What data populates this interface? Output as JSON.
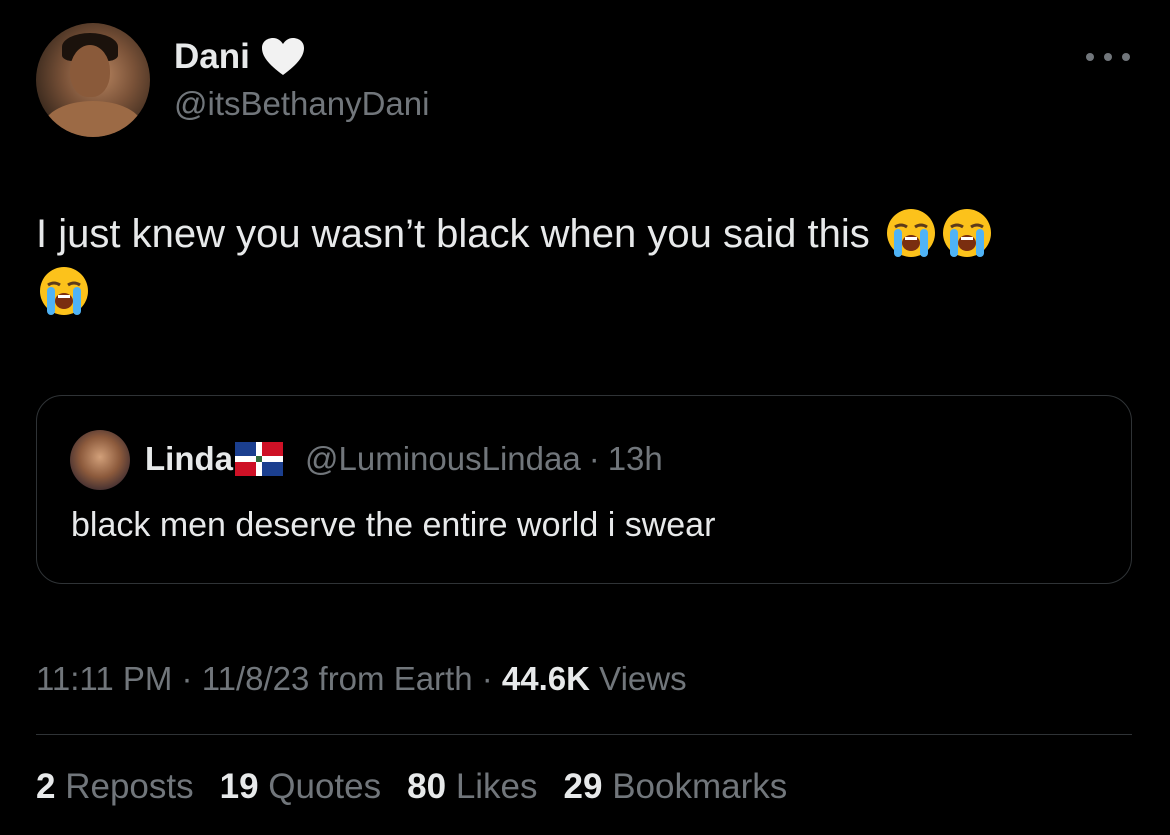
{
  "author": {
    "display_name": "Dani",
    "handle": "@itsBethanyDani",
    "badge_icon": "white-heart-icon"
  },
  "tweet": {
    "text": "I just knew you wasn’t black when you said this",
    "emoji_icon": "loudly-crying-face-icon",
    "emoji_count": 3
  },
  "quote": {
    "name": "Linda",
    "flag_icon": "dominican-republic-flag-icon",
    "handle": "@LuminousLindaa",
    "separator": "·",
    "time": "13h",
    "text": "black men deserve the entire world i swear"
  },
  "meta": {
    "time": "11:11 PM",
    "date": "11/8/23 from Earth",
    "separator": "·",
    "views_count": "44.6K",
    "views_label": "Views"
  },
  "stats": [
    {
      "count": "2",
      "label": "Reposts"
    },
    {
      "count": "19",
      "label": "Quotes"
    },
    {
      "count": "80",
      "label": "Likes"
    },
    {
      "count": "29",
      "label": "Bookmarks"
    }
  ],
  "colors": {
    "background": "#000000",
    "primary_text": "#e7e9ea",
    "secondary_text": "#71767b",
    "border": "#2f3336"
  }
}
